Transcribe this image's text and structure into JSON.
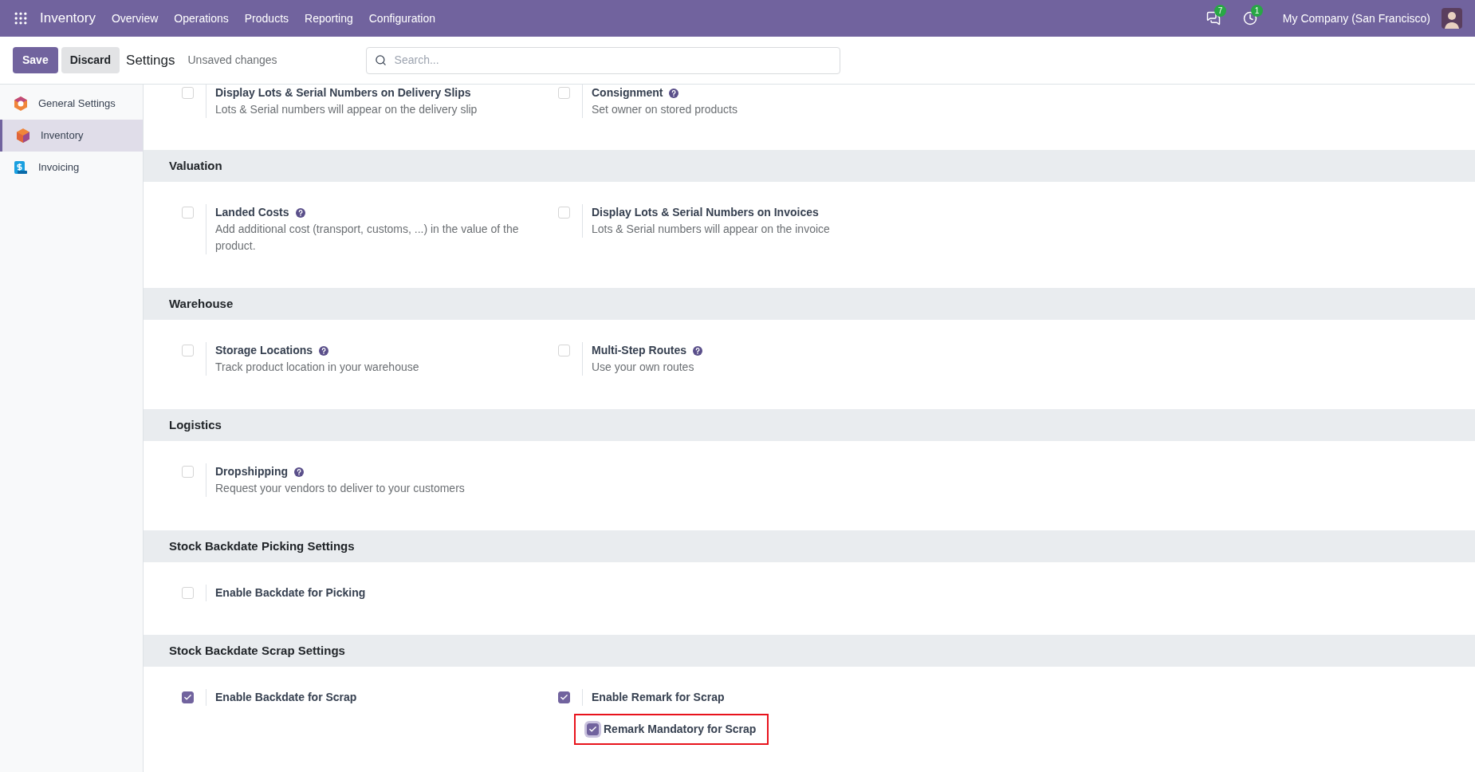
{
  "navbar": {
    "app_name": "Inventory",
    "menu": [
      "Overview",
      "Operations",
      "Products",
      "Reporting",
      "Configuration"
    ],
    "messages_count": "7",
    "activities_count": "1",
    "company": "My Company (San Francisco)"
  },
  "control_panel": {
    "save": "Save",
    "discard": "Discard",
    "title": "Settings",
    "status": "Unsaved changes",
    "search": {
      "placeholder": "Search..."
    }
  },
  "sidebar": {
    "items": [
      {
        "label": "General Settings",
        "kind": "general",
        "selected": false
      },
      {
        "label": "Inventory",
        "kind": "inventory",
        "selected": true
      },
      {
        "label": "Invoicing",
        "kind": "invoicing",
        "selected": false
      }
    ]
  },
  "sections": [
    {
      "settings": [
        {
          "label": "Display Lots & Serial Numbers on Delivery Slips",
          "checked": false,
          "help": false,
          "description": "Lots & Serial numbers will appear on the delivery slip"
        },
        {
          "label": "Consignment",
          "checked": false,
          "help": true,
          "description": "Set owner on stored products"
        }
      ]
    },
    {
      "title": "Valuation",
      "settings": [
        {
          "label": "Landed Costs",
          "checked": false,
          "help": true,
          "description": "Add additional cost (transport, customs, ...) in the value of the product."
        },
        {
          "label": "Display Lots & Serial Numbers on Invoices",
          "checked": false,
          "help": false,
          "description": "Lots & Serial numbers will appear on the invoice"
        }
      ]
    },
    {
      "title": "Warehouse",
      "settings": [
        {
          "label": "Storage Locations",
          "checked": false,
          "help": true,
          "description": "Track product location in your warehouse"
        },
        {
          "label": "Multi-Step Routes",
          "checked": false,
          "help": true,
          "description": "Use your own routes"
        }
      ]
    },
    {
      "title": "Logistics",
      "settings": [
        {
          "label": "Dropshipping",
          "checked": false,
          "help": true,
          "description": "Request your vendors to deliver to your customers"
        }
      ]
    },
    {
      "title": "Stock Backdate Picking Settings",
      "settings": [
        {
          "label": "Enable Backdate for Picking",
          "checked": false,
          "help": false
        }
      ]
    },
    {
      "title": "Stock Backdate Scrap Settings",
      "settings": [
        {
          "label": "Enable Backdate for Scrap",
          "checked": true,
          "help": false
        },
        {
          "label": "Enable Remark for Scrap",
          "checked": true,
          "help": false,
          "children": [
            {
              "label": "Remark Mandatory for Scrap",
              "checked": true,
              "highlighted": true
            }
          ]
        }
      ]
    }
  ]
}
